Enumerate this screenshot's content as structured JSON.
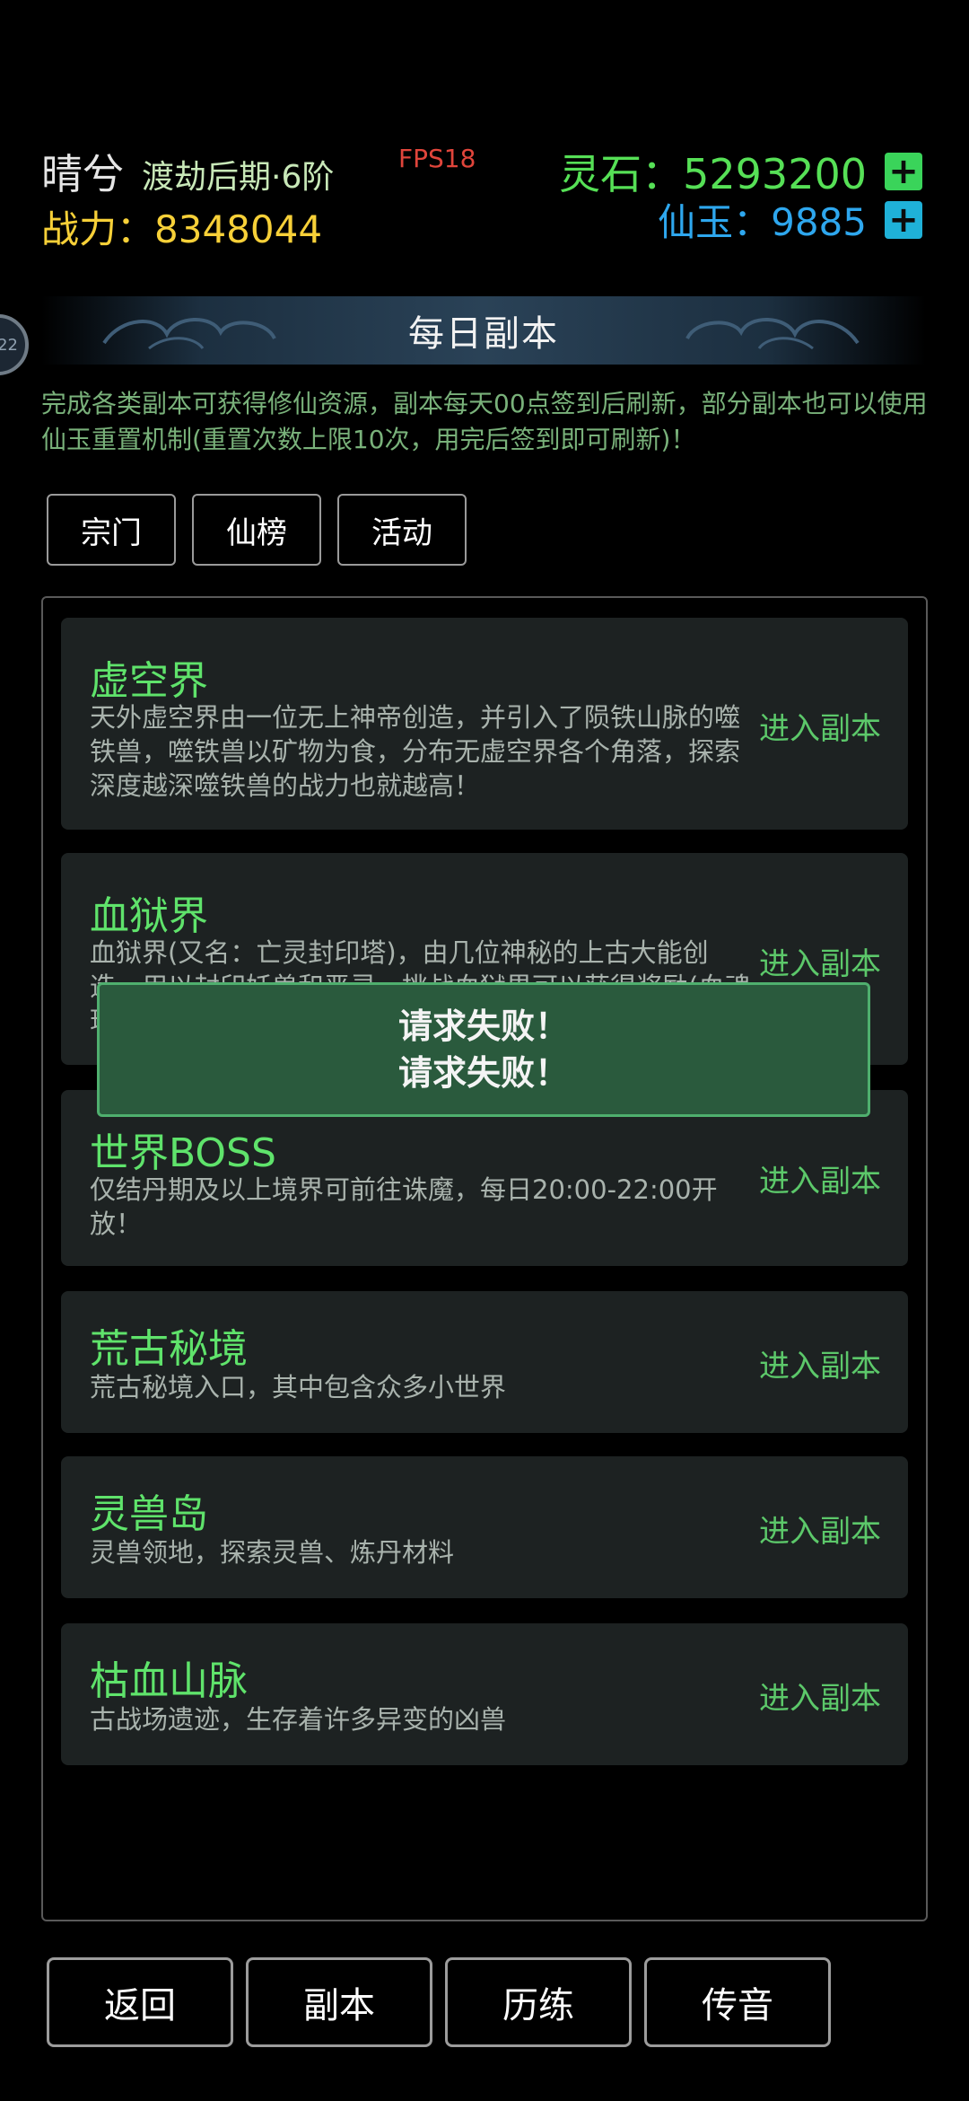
{
  "header": {
    "player_name": "晴兮",
    "realm": "渡劫后期·6阶",
    "fps": "FPS18",
    "power_label": "战力：",
    "power_value": "8348044",
    "spirit_stone_label": "灵石：",
    "spirit_stone_value": "5293200",
    "jade_label": "仙玉：",
    "jade_value": "9885",
    "plus": "+"
  },
  "side_badge": "22",
  "banner": {
    "title": "每日副本"
  },
  "description": "完成各类副本可获得修仙资源，副本每天00点签到后刷新，部分副本也可以使用仙玉重置机制(重置次数上限10次，用完后签到即可刷新)！",
  "tabs": [
    "宗门",
    "仙榜",
    "活动"
  ],
  "dungeons": [
    {
      "title": "虚空界",
      "desc": "天外虚空界由一位无上神帝创造，并引入了陨铁山脉的噬铁兽，噬铁兽以矿物为食，分布无虚空界各个角落，探索深度越深噬铁兽的战力也就越高！",
      "action": "进入副本"
    },
    {
      "title": "血狱界",
      "desc": "血狱界(又名：亡灵封印塔)，由几位神秘的上古大能创造，用以封印妖兽和恶灵，挑战血狱界可以获得奖励(血魂珠，修为)，层数越高奖励越高！",
      "action": "进入副本"
    },
    {
      "title": "世界BOSS",
      "desc": "仅结丹期及以上境界可前往诛魔，每日20:00-22:00开放！",
      "action": "进入副本"
    },
    {
      "title": "荒古秘境",
      "desc": "荒古秘境入口，其中包含众多小世界",
      "action": "进入副本"
    },
    {
      "title": "灵兽岛",
      "desc": "灵兽领地，探索灵兽、炼丹材料",
      "action": "进入副本"
    },
    {
      "title": "枯血山脉",
      "desc": "古战场遗迹，生存着许多异变的凶兽",
      "action": "进入副本"
    }
  ],
  "toast": {
    "line1": "请求失败！",
    "line2": "请求失败！"
  },
  "bottom_nav": [
    "返回",
    "副本",
    "历练",
    "传音"
  ],
  "colors": {
    "accent_green": "#5fe36b",
    "spirit_stone": "#56e056",
    "jade": "#2ea7ee",
    "power": "#f7d038",
    "fps": "#e0453b",
    "toast_bg": "#2a5a3d"
  }
}
